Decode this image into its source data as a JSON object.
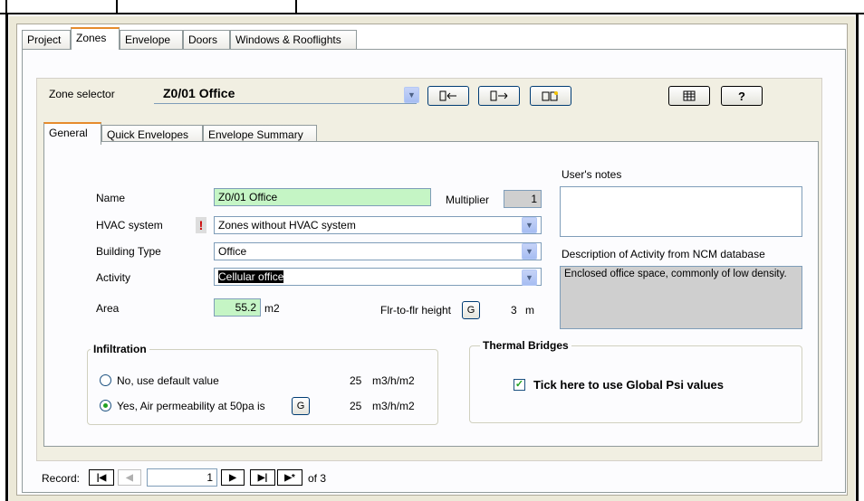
{
  "tabs": [
    "Project",
    "Zones",
    "Envelope",
    "Doors",
    "Windows & Rooflights"
  ],
  "active_tab": "Zones",
  "zone_selector": {
    "label": "Zone selector",
    "value": "Z0/01 Office"
  },
  "inner_tabs": [
    "General",
    "Quick Envelopes",
    "Envelope Summary"
  ],
  "general": {
    "name_label": "Name",
    "name_value": "Z0/01 Office",
    "multiplier_label": "Multiplier",
    "multiplier_value": "1",
    "hvac_label": "HVAC system",
    "hvac_value": "Zones without HVAC system",
    "building_type_label": "Building Type",
    "building_type_value": "Office",
    "activity_label": "Activity",
    "activity_value": "Cellular office",
    "area_label": "Area",
    "area_value": "55.2",
    "area_unit": "m2",
    "flr_label": "Flr-to-flr height",
    "flr_value": "3",
    "flr_unit": "m",
    "g_label": "G",
    "notes_label": "User's notes",
    "notes_value": "",
    "description_label": "Description of Activity from NCM database",
    "description_value": "Enclosed office space, commonly of low density."
  },
  "infiltration": {
    "title": "Infiltration",
    "option1": "No, use default value",
    "option1_value": "25",
    "option1_unit": "m3/h/m2",
    "option2": "Yes, Air permeability at 50pa is",
    "option2_value": "25",
    "option2_unit": "m3/h/m2",
    "selected": "option2"
  },
  "thermal_bridges": {
    "title": "Thermal Bridges",
    "checkbox_label": "Tick here to use Global Psi values",
    "checked": true
  },
  "record_nav": {
    "label": "Record:",
    "current": "1",
    "of_label": "of 3"
  }
}
